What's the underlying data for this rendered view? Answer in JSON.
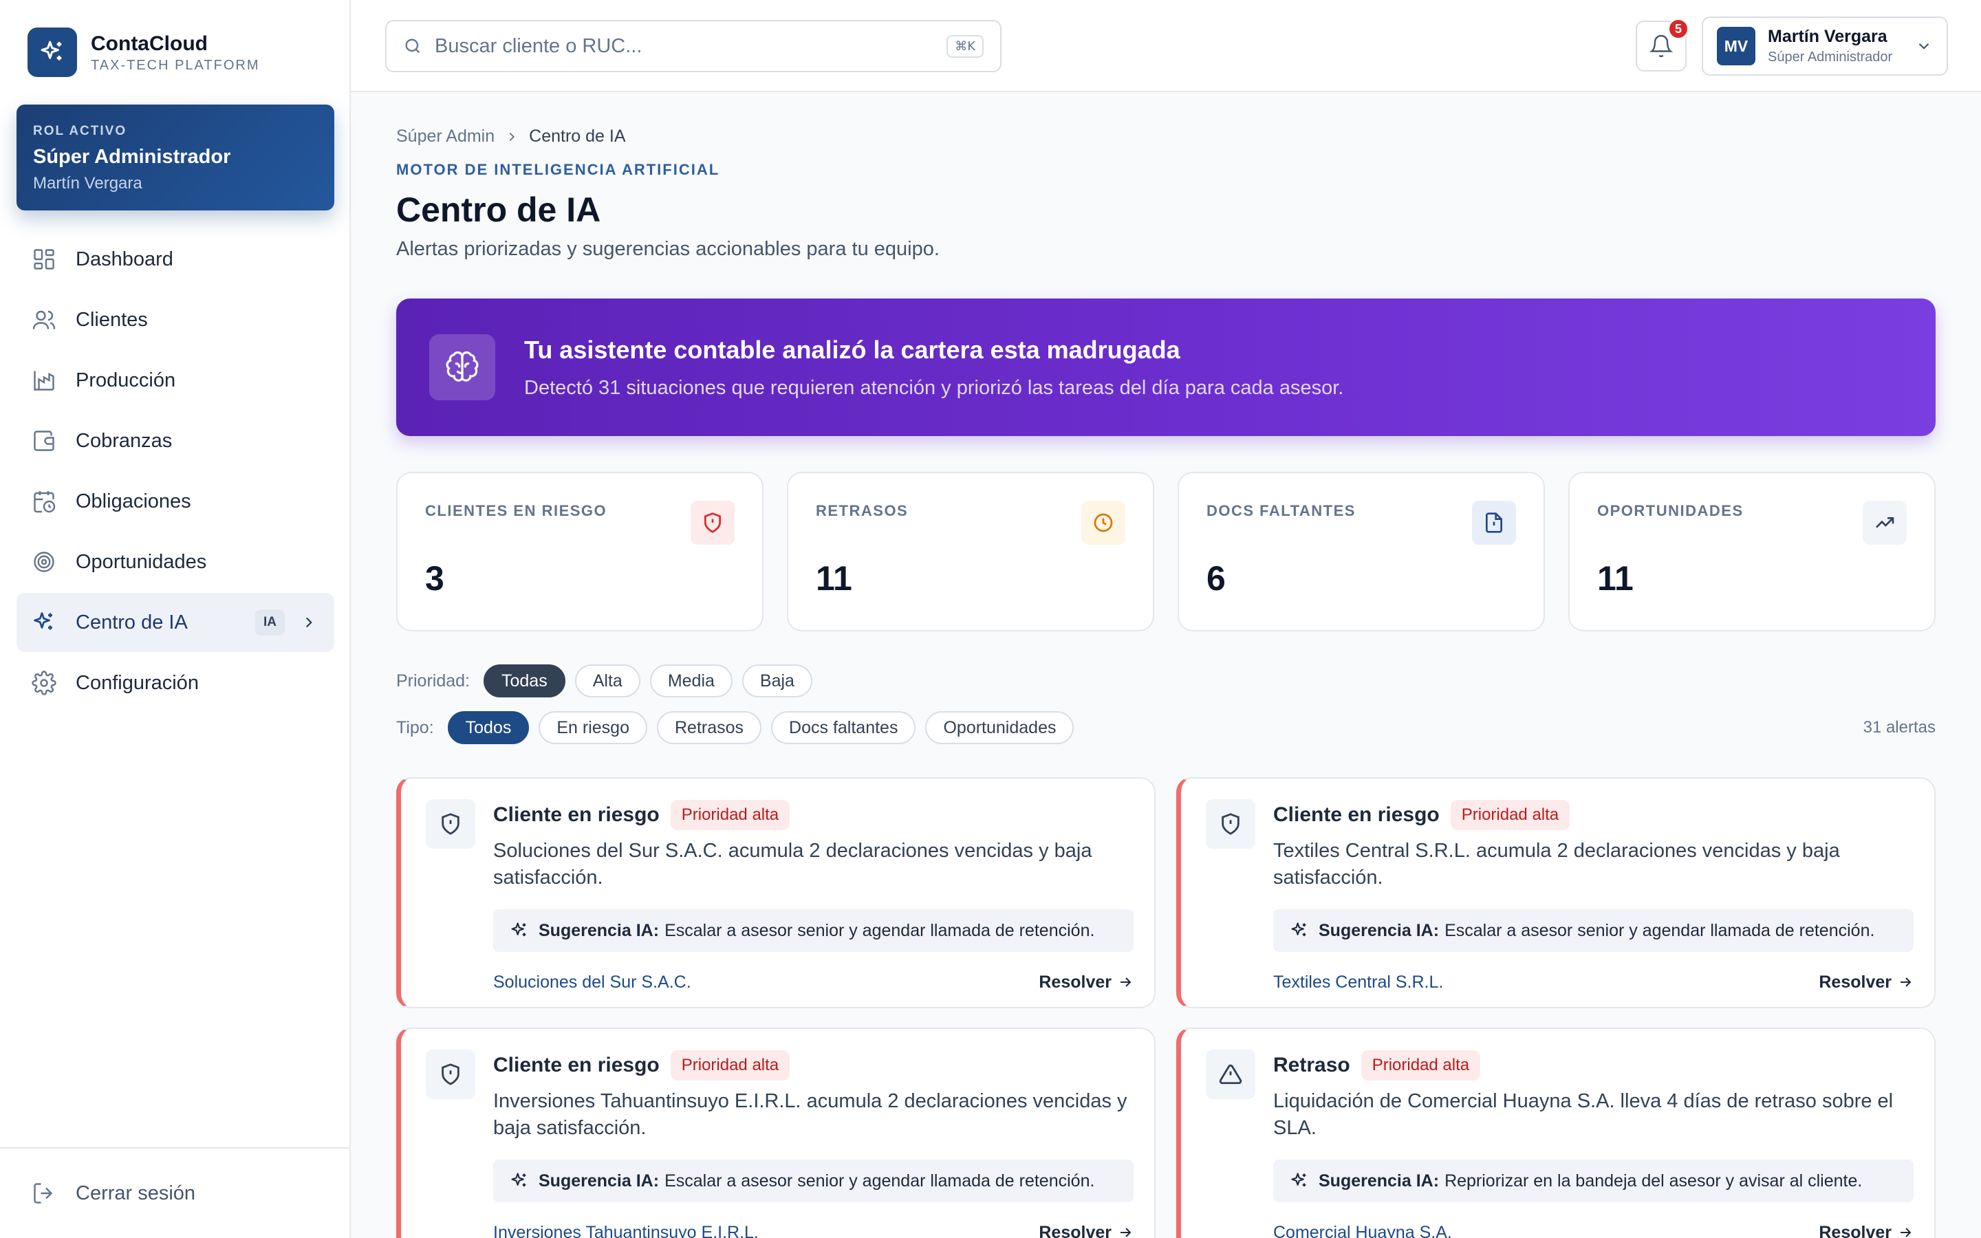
{
  "brand": {
    "name": "ContaCloud",
    "subtitle": "TAX-TECH PLATFORM"
  },
  "role_card": {
    "label": "ROL ACTIVO",
    "role": "Súper Administrador",
    "user": "Martín Vergara"
  },
  "nav": {
    "items": [
      {
        "label": "Dashboard",
        "icon": "dashboard-icon"
      },
      {
        "label": "Clientes",
        "icon": "users-icon"
      },
      {
        "label": "Producción",
        "icon": "production-chart-icon"
      },
      {
        "label": "Cobranzas",
        "icon": "wallet-icon"
      },
      {
        "label": "Obligaciones",
        "icon": "calendar-clock-icon"
      },
      {
        "label": "Oportunidades",
        "icon": "target-icon"
      },
      {
        "label": "Centro de IA",
        "icon": "sparkle-icon",
        "badge": "IA",
        "active": true
      },
      {
        "label": "Configuración",
        "icon": "gear-icon"
      }
    ],
    "logout": "Cerrar sesión"
  },
  "topbar": {
    "search_placeholder": "Buscar cliente o RUC...",
    "search_shortcut": "⌘K",
    "notifications_count": "5",
    "user": {
      "initials": "MV",
      "name": "Martín Vergara",
      "role": "Súper Administrador"
    }
  },
  "breadcrumb": {
    "parent": "Súper Admin",
    "current": "Centro de IA"
  },
  "header": {
    "eyebrow": "MOTOR DE INTELIGENCIA ARTIFICIAL",
    "title": "Centro de IA",
    "subtitle": "Alertas priorizadas y sugerencias accionables para tu equipo."
  },
  "banner": {
    "title": "Tu asistente contable analizó la cartera esta madrugada",
    "description": "Detectó 31 situaciones que requieren atención y priorizó las tareas del día para cada asesor."
  },
  "stats": [
    {
      "label": "CLIENTES EN RIESGO",
      "value": "3",
      "icon": "shield-alert-icon",
      "color": "#dc2626",
      "bg": "#fdeaea"
    },
    {
      "label": "RETRASOS",
      "value": "11",
      "icon": "clock-icon",
      "color": "#d97706",
      "bg": "#fef6e4"
    },
    {
      "label": "DOCS FALTANTES",
      "value": "6",
      "icon": "file-alert-icon",
      "color": "#1e4a86",
      "bg": "#e8eef7"
    },
    {
      "label": "OPORTUNIDADES",
      "value": "11",
      "icon": "trending-up-icon",
      "color": "#334155",
      "bg": "#f1f5f9"
    }
  ],
  "filters": {
    "priority_label": "Prioridad:",
    "priority_options": [
      "Todas",
      "Alta",
      "Media",
      "Baja"
    ],
    "priority_selected": "Todas",
    "type_label": "Tipo:",
    "type_options": [
      "Todos",
      "En riesgo",
      "Retrasos",
      "Docs faltantes",
      "Oportunidades"
    ],
    "type_selected": "Todos",
    "count_text": "31 alertas"
  },
  "alerts": [
    {
      "title": "Cliente en riesgo",
      "priority": "Prioridad alta",
      "icon": "shield-alert-icon",
      "description": "Soluciones del Sur S.A.C. acumula 2 declaraciones vencidas y baja satisfacción.",
      "suggestion_label": "Sugerencia IA:",
      "suggestion": "Escalar a asesor senior y agendar llamada de retención.",
      "client": "Soluciones del Sur S.A.C.",
      "action": "Resolver"
    },
    {
      "title": "Cliente en riesgo",
      "priority": "Prioridad alta",
      "icon": "shield-alert-icon",
      "description": "Textiles Central S.R.L. acumula 2 declaraciones vencidas y baja satisfacción.",
      "suggestion_label": "Sugerencia IA:",
      "suggestion": "Escalar a asesor senior y agendar llamada de retención.",
      "client": "Textiles Central S.R.L.",
      "action": "Resolver"
    },
    {
      "title": "Cliente en riesgo",
      "priority": "Prioridad alta",
      "icon": "shield-alert-icon",
      "description": "Inversiones Tahuantinsuyo E.I.R.L. acumula 2 declaraciones vencidas y baja satisfacción.",
      "suggestion_label": "Sugerencia IA:",
      "suggestion": "Escalar a asesor senior y agendar llamada de retención.",
      "client": "Inversiones Tahuantinsuyo E.I.R.L.",
      "action": "Resolver"
    },
    {
      "title": "Retraso",
      "priority": "Prioridad alta",
      "icon": "warning-triangle-icon",
      "description": "Liquidación de Comercial Huayna S.A. lleva 4 días de retraso sobre el SLA.",
      "suggestion_label": "Sugerencia IA:",
      "suggestion": "Repriorizar en la bandeja del asesor y avisar al cliente.",
      "client": "Comercial Huayna S.A.",
      "action": "Resolver"
    }
  ],
  "colors": {
    "brand": "#1e4a86",
    "purple": "#6d2fd0",
    "danger": "#dc2626",
    "alert_border": "#f06b6b"
  }
}
